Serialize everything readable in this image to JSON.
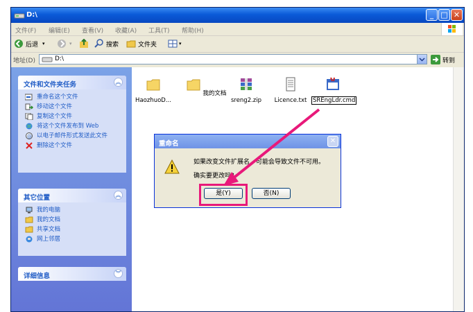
{
  "window": {
    "title": "D:\\",
    "menu": [
      "文件(F)",
      "编辑(E)",
      "查看(V)",
      "收藏(A)",
      "工具(T)",
      "帮助(H)"
    ],
    "toolbar": {
      "back": "后退",
      "search": "搜索",
      "folders": "文件夹"
    },
    "address": {
      "label": "地址(D)",
      "value": "D:\\",
      "go": "转到"
    }
  },
  "sidebar": {
    "tasks": {
      "title": "文件和文件夹任务",
      "items": [
        "重命名这个文件",
        "移动这个文件",
        "复制这个文件",
        "将这个文件发布到 Web",
        "以电子邮件形式发送此文件",
        "删除这个文件"
      ]
    },
    "places": {
      "title": "其它位置",
      "items": [
        "我的电脑",
        "我的文档",
        "共享文档",
        "网上邻居"
      ]
    },
    "details": {
      "title": "详细信息"
    }
  },
  "files": [
    "HaozhuoD...",
    "我的文档",
    "sreng2.zip",
    "Licence.txt",
    "SREngLdr.cmd"
  ],
  "dialog": {
    "title": "重命名",
    "message_line1": "如果改变文件扩展名，可能会导致文件不可用。",
    "message_line2": "确实要更改吗?",
    "yes": "是(Y)",
    "no": "否(N)"
  },
  "colors": {
    "title_bar": "#0a5ad8",
    "sidebar": "#6b8fe0",
    "link": "#215dc6",
    "highlight": "#e8197a"
  }
}
